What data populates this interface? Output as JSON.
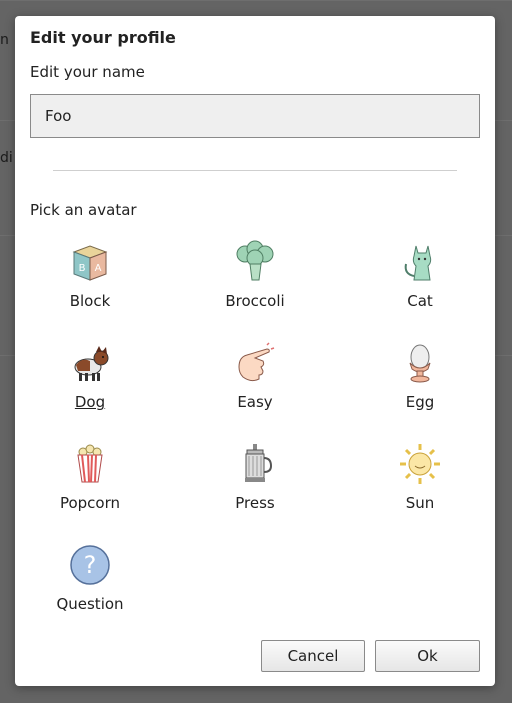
{
  "background": {
    "fragments": [
      "n",
      "di"
    ]
  },
  "dialog": {
    "title": "Edit your profile",
    "name_label": "Edit your name",
    "name_value": "Foo",
    "avatar_label": "Pick an avatar",
    "selected_avatar": "Dog",
    "avatars": [
      {
        "label": "Block",
        "icon": "block-icon"
      },
      {
        "label": "Broccoli",
        "icon": "broccoli-icon"
      },
      {
        "label": "Cat",
        "icon": "cat-icon"
      },
      {
        "label": "Dog",
        "icon": "dog-icon"
      },
      {
        "label": "Easy",
        "icon": "easy-hand-icon"
      },
      {
        "label": "Egg",
        "icon": "egg-icon"
      },
      {
        "label": "Popcorn",
        "icon": "popcorn-icon"
      },
      {
        "label": "Press",
        "icon": "press-icon"
      },
      {
        "label": "Sun",
        "icon": "sun-icon"
      },
      {
        "label": "Question",
        "icon": "question-icon"
      }
    ],
    "buttons": {
      "cancel": "Cancel",
      "ok": "Ok"
    }
  }
}
